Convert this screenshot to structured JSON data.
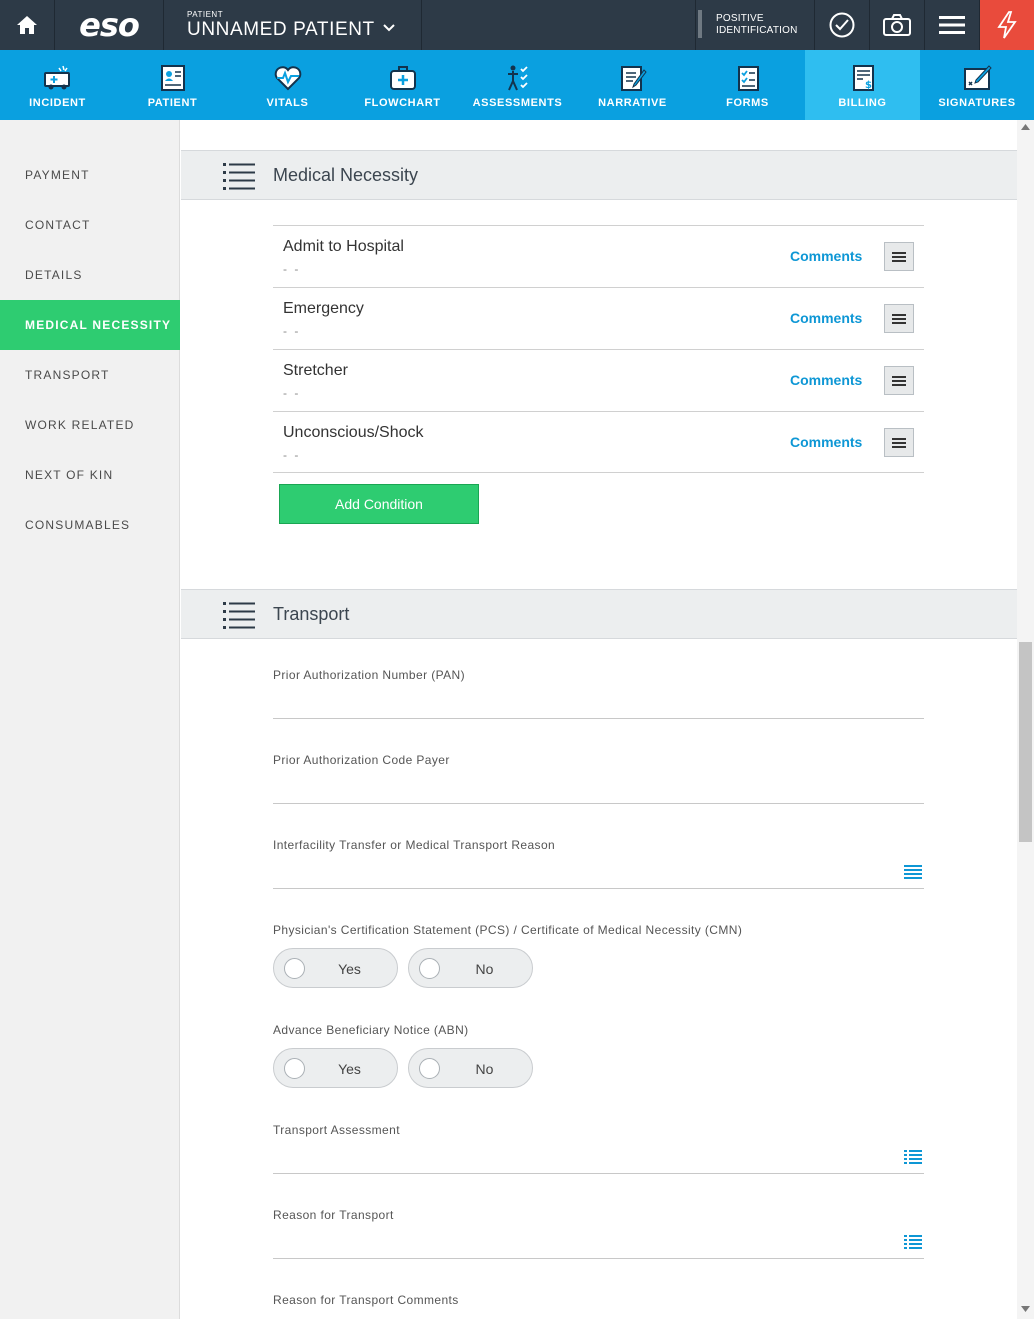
{
  "topbar": {
    "logo": "eso",
    "patient_label": "PATIENT",
    "patient_name": "UNNAMED PATIENT",
    "positive_id_line1": "POSITIVE",
    "positive_id_line2": "IDENTIFICATION"
  },
  "tabs": [
    {
      "label": "INCIDENT",
      "icon": "ambulance-icon"
    },
    {
      "label": "PATIENT",
      "icon": "patient-card-icon"
    },
    {
      "label": "VITALS",
      "icon": "heartbeat-icon"
    },
    {
      "label": "FLOWCHART",
      "icon": "medkit-icon"
    },
    {
      "label": "ASSESSMENTS",
      "icon": "body-checklist-icon"
    },
    {
      "label": "NARRATIVE",
      "icon": "notepad-pen-icon"
    },
    {
      "label": "FORMS",
      "icon": "checklist-icon"
    },
    {
      "label": "BILLING",
      "icon": "billing-doc-icon",
      "active": true
    },
    {
      "label": "SIGNATURES",
      "icon": "signature-icon"
    }
  ],
  "sidebar": {
    "items": [
      {
        "label": "PAYMENT"
      },
      {
        "label": "CONTACT"
      },
      {
        "label": "DETAILS"
      },
      {
        "label": "MEDICAL NECESSITY",
        "active": true
      },
      {
        "label": "TRANSPORT"
      },
      {
        "label": "WORK RELATED"
      },
      {
        "label": "NEXT OF KIN"
      },
      {
        "label": "CONSUMABLES"
      }
    ]
  },
  "medical_necessity": {
    "title": "Medical Necessity",
    "conditions": [
      {
        "name": "Admit to Hospital",
        "value": "- -",
        "comments": "Comments"
      },
      {
        "name": "Emergency",
        "value": "- -",
        "comments": "Comments"
      },
      {
        "name": "Stretcher",
        "value": "- -",
        "comments": "Comments"
      },
      {
        "name": "Unconscious/Shock",
        "value": "- -",
        "comments": "Comments"
      }
    ],
    "add_button": "Add Condition"
  },
  "transport": {
    "title": "Transport",
    "pan_label": "Prior Authorization Number (PAN)",
    "pan_value": "",
    "payer_label": "Prior Authorization Code Payer",
    "payer_value": "",
    "reason_ift_label": "Interfacility Transfer or Medical Transport Reason",
    "reason_ift_value": "",
    "pcs_label": "Physician's Certification Statement (PCS) / Certificate of Medical Necessity (CMN)",
    "abn_label": "Advance Beneficiary Notice (ABN)",
    "yes": "Yes",
    "no": "No",
    "assessment_label": "Transport Assessment",
    "assessment_value": "",
    "reason_label": "Reason for Transport",
    "reason_value": "",
    "reason_comments_label": "Reason for Transport Comments"
  },
  "colors": {
    "topbar": "#2d3a47",
    "tabbar": "#0aa0e0",
    "active_tab": "#2fbef0",
    "accent_green": "#2ecc71",
    "alert_red": "#e94b3c",
    "link_blue": "#0e97d5"
  }
}
